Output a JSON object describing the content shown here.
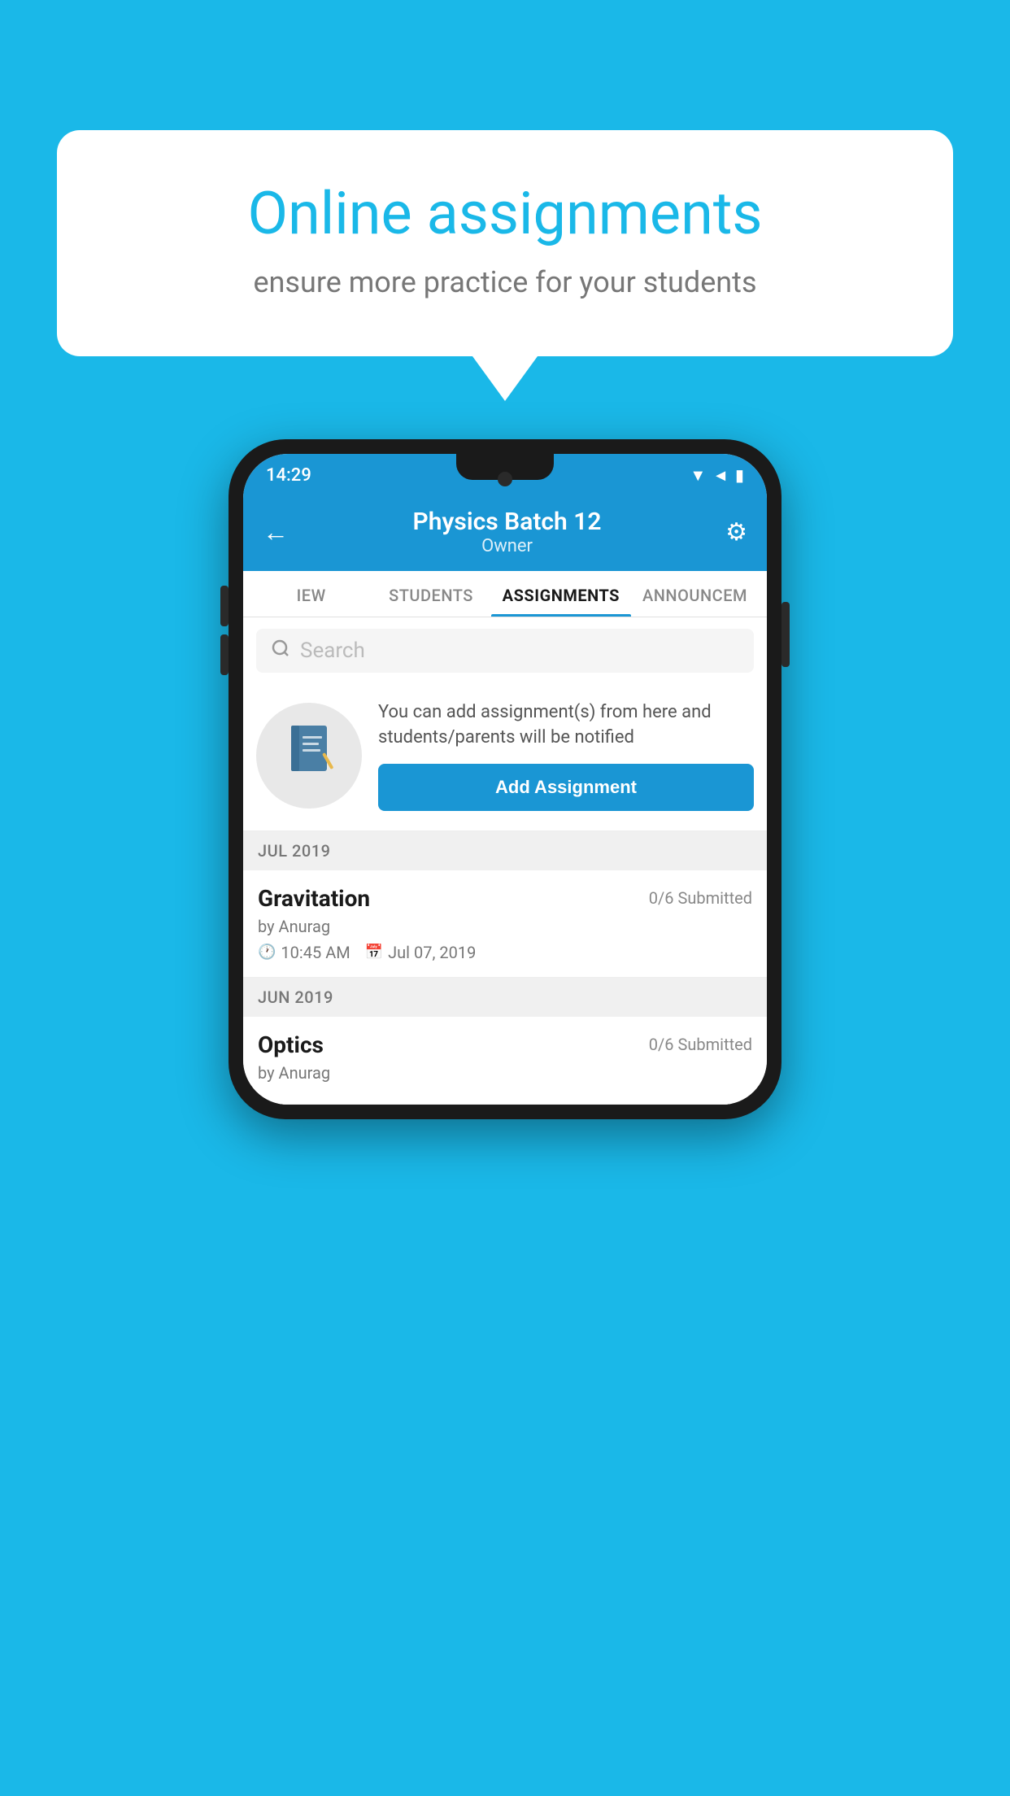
{
  "background": {
    "color": "#1ab8e8"
  },
  "speech_bubble": {
    "title": "Online assignments",
    "subtitle": "ensure more practice for your students"
  },
  "phone": {
    "status_bar": {
      "time": "14:29",
      "icons": "▼◄▮"
    },
    "header": {
      "title": "Physics Batch 12",
      "subtitle": "Owner",
      "back_label": "←",
      "gear_label": "⚙"
    },
    "tabs": [
      {
        "label": "IEW",
        "active": false
      },
      {
        "label": "STUDENTS",
        "active": false
      },
      {
        "label": "ASSIGNMENTS",
        "active": true
      },
      {
        "label": "ANNOUNCEM",
        "active": false
      }
    ],
    "search": {
      "placeholder": "Search"
    },
    "promo": {
      "text": "You can add assignment(s) from here and students/parents will be notified",
      "button_label": "Add Assignment"
    },
    "sections": [
      {
        "header": "JUL 2019",
        "assignments": [
          {
            "name": "Gravitation",
            "submitted": "0/6 Submitted",
            "by": "by Anurag",
            "time": "10:45 AM",
            "date": "Jul 07, 2019"
          }
        ]
      },
      {
        "header": "JUN 2019",
        "assignments": [
          {
            "name": "Optics",
            "submitted": "0/6 Submitted",
            "by": "by Anurag",
            "time": "",
            "date": ""
          }
        ]
      }
    ]
  }
}
